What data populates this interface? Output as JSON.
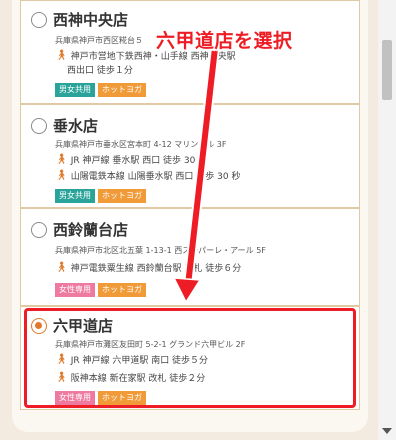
{
  "stores": [
    {
      "name": "西神中央店",
      "address": "兵庫県神戸市西区糀台５",
      "access": [
        {
          "line": "神戸市営地下鉄西神・山手線 西神中央駅",
          "cont": "西出口 徒歩１分"
        }
      ],
      "tags": [
        "男女共用",
        "ホットヨガ"
      ],
      "selected": false
    },
    {
      "name": "垂水店",
      "address": "兵庫県神戸市垂水区宮本町 4-12 マリンビル 3F",
      "access": [
        {
          "line": "JR 神戸線 垂水駅 西口 徒歩 30 秒"
        },
        {
          "line": "山陽電鉄本線 山陽垂水駅 西口 徒歩 30 秒"
        }
      ],
      "tags": [
        "男女共用",
        "ホットヨガ"
      ],
      "selected": false
    },
    {
      "name": "西鈴蘭台店",
      "address": "兵庫県神戸市北区北五葉 1-13-1 西スーパーレ・アール 5F",
      "access": [
        {
          "line": "神戸電鉄粟生線 西鈴蘭台駅 改札 徒歩６分"
        }
      ],
      "tags": [
        "女性専用",
        "ホットヨガ"
      ],
      "selected": false
    },
    {
      "name": "六甲道店",
      "address": "兵庫県神戸市灘区友田町 5-2-1 グランド六甲ビル 2F",
      "access": [
        {
          "line": "JR 神戸線 六甲道駅 南口 徒歩５分"
        },
        {
          "line": "阪神本線 新在家駅 改札 徒歩２分"
        }
      ],
      "tags": [
        "女性専用",
        "ホットヨガ"
      ],
      "selected": true
    }
  ],
  "annotation": "六甲道店を選択",
  "colors": {
    "accent": "#ee1c24",
    "teal": "#2aa39a",
    "pink": "#ef7aa0",
    "orange": "#f19a38",
    "card_border": "#e1c9a3"
  }
}
